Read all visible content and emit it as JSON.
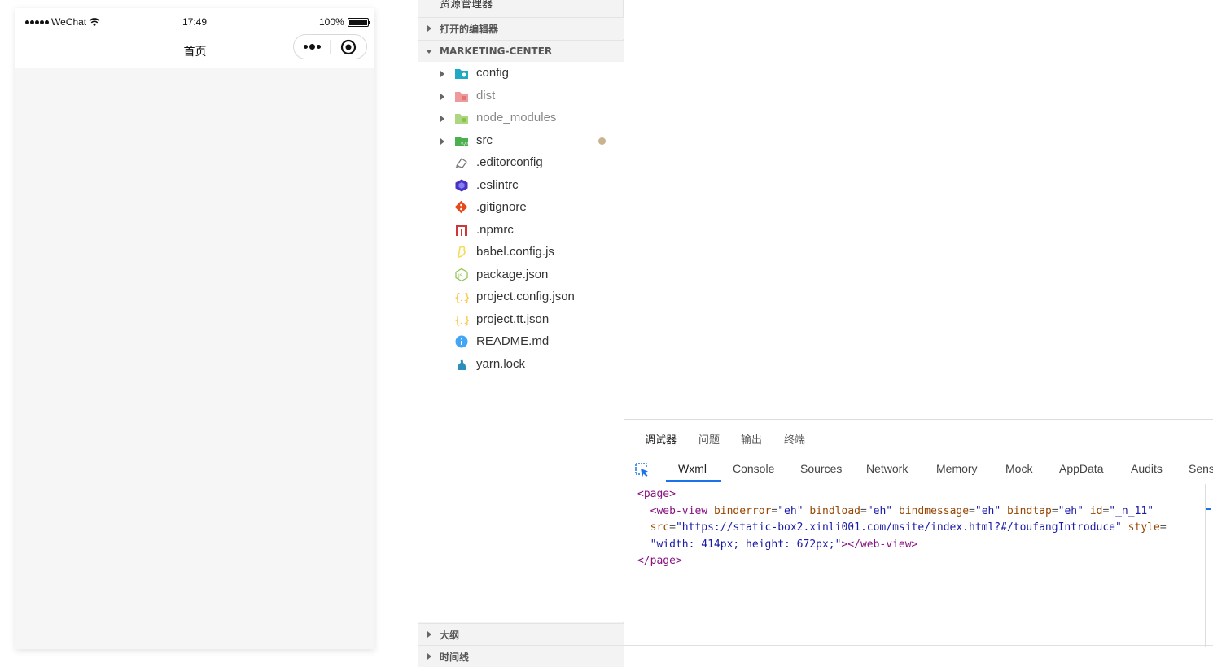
{
  "simulator": {
    "status": {
      "carrier": "WeChat",
      "time": "17:49",
      "battery": "100%"
    },
    "page_title": "首页"
  },
  "explorer": {
    "title": "资源管理器",
    "open_editors": "打开的编辑器",
    "project": "MARKETING-CENTER",
    "items": [
      {
        "name": "config",
        "type": "folder",
        "color": "#20a9c2",
        "dim": false
      },
      {
        "name": "dist",
        "type": "folder",
        "color": "#e57373",
        "dim": true
      },
      {
        "name": "node_modules",
        "type": "folder",
        "color": "#8bc34a",
        "dim": true
      },
      {
        "name": "src",
        "type": "folder",
        "color": "#4caf50",
        "dim": false,
        "modified": true
      },
      {
        "name": ".editorconfig",
        "type": "file",
        "icon": "editorconfig-icon"
      },
      {
        "name": ".eslintrc",
        "type": "file",
        "icon": "eslint-icon",
        "color": "#4b32c3"
      },
      {
        "name": ".gitignore",
        "type": "file",
        "icon": "git-icon",
        "color": "#e64a19"
      },
      {
        "name": ".npmrc",
        "type": "file",
        "icon": "npm-icon",
        "color": "#cb3837"
      },
      {
        "name": "babel.config.js",
        "type": "file",
        "icon": "babel-icon",
        "color": "#f5da55"
      },
      {
        "name": "package.json",
        "type": "file",
        "icon": "nodejs-icon",
        "color": "#8bc34a"
      },
      {
        "name": "project.config.json",
        "type": "file",
        "icon": "json-icon",
        "color": "#fbc02d"
      },
      {
        "name": "project.tt.json",
        "type": "file",
        "icon": "json-icon",
        "color": "#fbc02d"
      },
      {
        "name": "README.md",
        "type": "file",
        "icon": "info-icon",
        "color": "#42a5f5"
      },
      {
        "name": "yarn.lock",
        "type": "file",
        "icon": "yarn-icon",
        "color": "#2c8ebb"
      }
    ],
    "outline": "大纲",
    "timeline": "时间线"
  },
  "devtools": {
    "tabs": [
      "调试器",
      "问题",
      "输出",
      "终端"
    ],
    "panels": [
      "Wxml",
      "Console",
      "Sources",
      "Network",
      "Memory",
      "Mock",
      "AppData",
      "Audits",
      "Sens"
    ],
    "code": {
      "page_open": "<page>",
      "web_view_tag": "<web-view",
      "a1": "binderror",
      "v1": "\"eh\"",
      "a2": "bindload",
      "v2": "\"eh\"",
      "a3": "bindmessage",
      "v3": "\"eh\"",
      "a4": "bindtap",
      "v4": "\"eh\"",
      "a5": "id",
      "v5": "\"_n_11\"",
      "a6": "src",
      "v6": "\"https://static-box2.xinli001.com/msite/index.html?#/toufangIntroduce\"",
      "a7": "style",
      "v7": "\"width: 414px; height: 672px;\"",
      "web_view_close": "></web-view>",
      "page_close": "</page>"
    }
  }
}
